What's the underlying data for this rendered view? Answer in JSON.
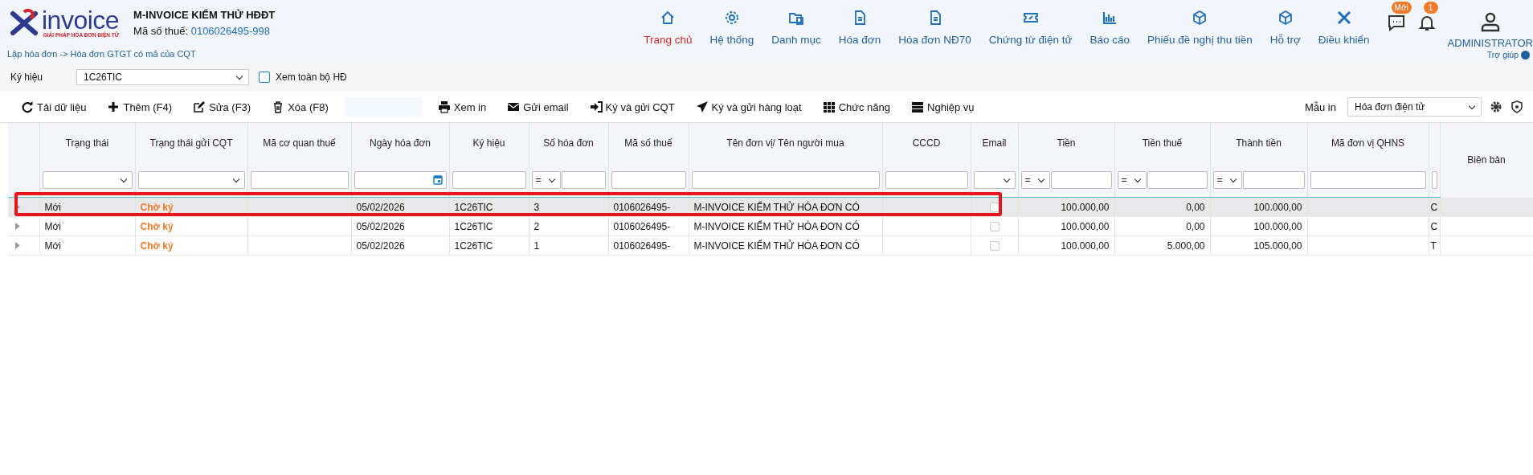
{
  "header": {
    "logo": {
      "brand": "invoice",
      "tagline": "GIẢI PHÁP HÓA ĐƠN ĐIỆN TỬ"
    },
    "company": "M-INVOICE KIỂM THỬ HĐĐT",
    "tax_label": "Mã số thuế:",
    "tax_code": "0106026495-998",
    "breadcrumb": "Lập hóa đơn -> Hóa đơn GTGT có mã của CQT",
    "nav": [
      {
        "label": "Trang chủ",
        "selected": true
      },
      {
        "label": "Hệ thống",
        "selected": false
      },
      {
        "label": "Danh mục",
        "selected": false
      },
      {
        "label": "Hóa đơn",
        "selected": false
      },
      {
        "label": "Hóa đơn NĐ70",
        "selected": false
      },
      {
        "label": "Chứng từ điện tử",
        "selected": false
      },
      {
        "label": "Báo cáo",
        "selected": false
      },
      {
        "label": "Phiếu đề nghị thu tiền",
        "selected": false
      },
      {
        "label": "Hỗ trợ",
        "selected": false
      },
      {
        "label": "Điều khiển",
        "selected": false
      }
    ],
    "messages_badge": "Mới",
    "notifications_badge": "1",
    "user": "ADMINISTRATOR",
    "help": "Trợ giúp"
  },
  "filter_bar": {
    "symbol_label": "Ký hiệu",
    "symbol_value": "1C26TIC",
    "show_all": {
      "label": "Xem toàn bộ HĐ",
      "checked": false
    }
  },
  "toolbar": {
    "buttons": [
      "Tải dữ liệu",
      "Thêm (F4)",
      "Sửa (F3)",
      "Xóa (F8)",
      "Xem in",
      "Gửi email",
      "Ký và gửi CQT",
      "Ký và gửi hàng loạt",
      "Chức năng",
      "Nghiệp vụ"
    ],
    "template_label": "Mẫu in",
    "template_value": "Hóa đơn điện tử"
  },
  "table": {
    "columns": [
      {
        "label": "Trạng thái"
      },
      {
        "label": "Trạng thái gửi CQT"
      },
      {
        "label": "Mã cơ quan thuế"
      },
      {
        "label": "Ngày hóa đơn"
      },
      {
        "label": "Ký hiệu"
      },
      {
        "label": "Số hóa đơn",
        "op": "="
      },
      {
        "label": "Mã số thuế"
      },
      {
        "label": "Tên đơn vị/ Tên người mua"
      },
      {
        "label": "CCCD"
      },
      {
        "label": "Email"
      },
      {
        "label": "Tiền",
        "op": "="
      },
      {
        "label": "Tiền thuế",
        "op": "="
      },
      {
        "label": "Thành tiền",
        "op": "="
      },
      {
        "label": "Mã đơn vị QHNS"
      },
      {
        "label": "Biên bản"
      }
    ],
    "rows": [
      {
        "selected": true,
        "status": "Mới",
        "cqt_status": "Chờ ký",
        "date": "05/02/2026",
        "symbol": "1C26TIC",
        "number": "3",
        "tax_code": "0106026495-",
        "buyer": "M-INVOICE KIỂM THỬ HÓA ĐƠN CÓ",
        "email_checked": false,
        "amount": "100.000,00",
        "tax": "0,00",
        "total": "100.000,00",
        "column_15": "C"
      },
      {
        "selected": false,
        "status": "Mới",
        "cqt_status": "Chờ ký",
        "date": "05/02/2026",
        "symbol": "1C26TIC",
        "number": "2",
        "tax_code": "0106026495-",
        "buyer": "M-INVOICE KIỂM THỬ HÓA ĐƠN CÓ",
        "email_checked": false,
        "amount": "100.000,00",
        "tax": "0,00",
        "total": "100.000,00",
        "column_15": "C"
      },
      {
        "selected": false,
        "status": "Mới",
        "cqt_status": "Chờ ký",
        "date": "05/02/2026",
        "symbol": "1C26TIC",
        "number": "1",
        "tax_code": "0106026495-",
        "buyer": "M-INVOICE KIỂM THỬ HÓA ĐƠN CÓ",
        "email_checked": false,
        "amount": "100.000,00",
        "tax": "5.000,00",
        "total": "105.000,00",
        "column_15": "T"
      }
    ]
  }
}
